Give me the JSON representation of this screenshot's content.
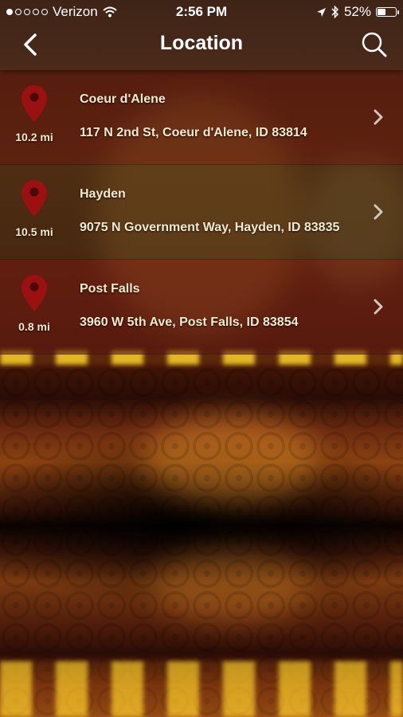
{
  "status_bar": {
    "carrier": "Verizon",
    "signal_bars_filled": 1,
    "signal_bars_total": 5,
    "time": "2:56 PM",
    "battery_percent_text": "52%",
    "battery_level": 0.52,
    "icons": [
      "wifi-icon",
      "location-arrow-icon",
      "bluetooth-icon",
      "battery-icon"
    ]
  },
  "nav": {
    "title": "Location",
    "back_icon": "chevron-left-icon",
    "search_icon": "search-icon"
  },
  "locations": [
    {
      "name": "Coeur d'Alene",
      "address": "117 N 2nd St, Coeur d'Alene, ID 83814",
      "distance": "10.2 mi"
    },
    {
      "name": "Hayden",
      "address": "9075 N Government Way, Hayden, ID 83835",
      "distance": "10.5 mi"
    },
    {
      "name": "Post Falls",
      "address": "3960 W 5th Ave, Post Falls, ID 83854",
      "distance": "0.8 mi"
    }
  ],
  "colors": {
    "pin": "#9b1010",
    "text": "#f3ead0",
    "nav_bar": "#4a2a1a"
  }
}
